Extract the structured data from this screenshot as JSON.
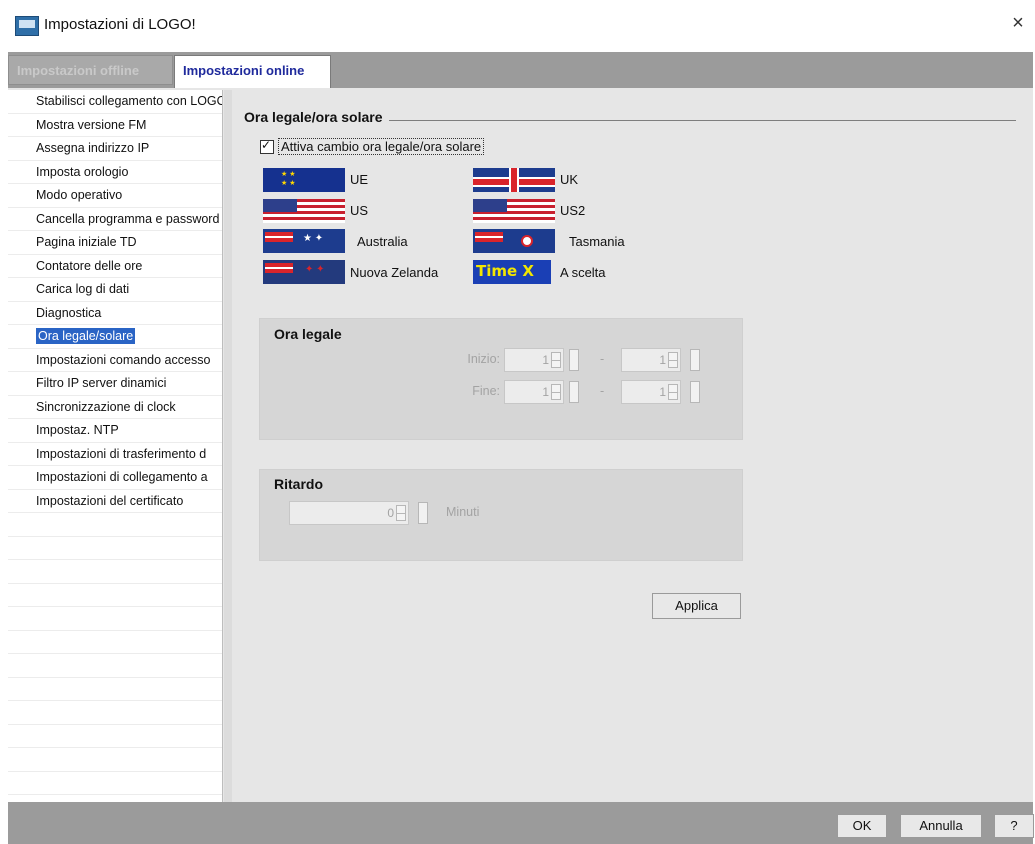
{
  "window": {
    "title": "Impostazioni di LOGO!",
    "close": "×"
  },
  "tabs": [
    {
      "label": "Impostazioni offline"
    },
    {
      "label": "Impostazioni online"
    }
  ],
  "sidebar": {
    "items": [
      {
        "label": "Stabilisci collegamento con LOGO"
      },
      {
        "label": "Mostra versione FM"
      },
      {
        "label": "Assegna indirizzo IP"
      },
      {
        "label": "Imposta orologio"
      },
      {
        "label": "Modo operativo"
      },
      {
        "label": "Cancella programma e password"
      },
      {
        "label": "Pagina iniziale TD"
      },
      {
        "label": "Contatore delle ore"
      },
      {
        "label": "Carica log di dati"
      },
      {
        "label": "Diagnostica"
      },
      {
        "label": "Ora legale/solare"
      },
      {
        "label": "Impostazioni comando accesso"
      },
      {
        "label": "Filtro IP server dinamici"
      },
      {
        "label": "Sincronizzazione di clock"
      },
      {
        "label": "Impostaz. NTP"
      },
      {
        "label": "Impostazioni di trasferimento d"
      },
      {
        "label": "Impostazioni di collegamento a"
      },
      {
        "label": "Impostazioni del certificato"
      }
    ]
  },
  "main": {
    "section_title": "Ora legale/ora solare",
    "checkbox_label": "Attiva cambio ora legale/ora solare",
    "regions": {
      "ue": "UE",
      "uk": "UK",
      "us": "US",
      "us2": "US2",
      "australia": "Australia",
      "tasmania": "Tasmania",
      "nz": "Nuova Zelanda",
      "custom": "A scelta",
      "custom_flag_text": "Time X"
    },
    "ora_legale": {
      "title": "Ora legale",
      "start_label": "Inizio:",
      "end_label": "Fine:",
      "separator": "-",
      "start_day": "1",
      "start_month": "1",
      "end_day": "1",
      "end_month": "1"
    },
    "ritardo": {
      "title": "Ritardo",
      "value": "0",
      "unit": "Minuti"
    },
    "apply_label": "Applica"
  },
  "footer": {
    "ok": "OK",
    "cancel": "Annulla",
    "help": "?"
  }
}
